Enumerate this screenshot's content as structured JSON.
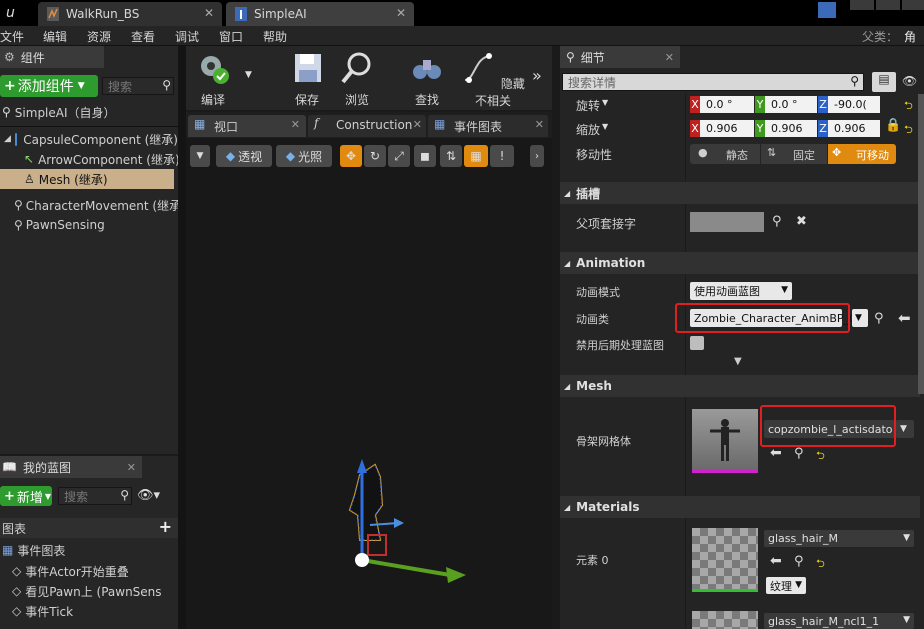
{
  "tabs": [
    {
      "label": "WalkRun_BS"
    },
    {
      "label": "SimpleAI"
    }
  ],
  "menu": [
    "文件",
    "编辑",
    "资源",
    "查看",
    "调试",
    "窗口",
    "帮助"
  ],
  "parent_label": "父类：",
  "parent_value": "角色",
  "components": {
    "header": "组件",
    "add_button": "添加组件",
    "search_placeholder": "搜索",
    "self_item": "SimpleAI（自身）",
    "items": [
      "CapsuleComponent (继承)",
      "ArrowComponent (继承)",
      "Mesh (继承)",
      "CharacterMovement (继承)",
      "PawnSensing"
    ]
  },
  "toolbar": {
    "compile": "编译",
    "save": "保存",
    "browse": "浏览",
    "find": "查找",
    "hide_unrelated": "隐藏不相关"
  },
  "editor_tabs": [
    "视口",
    "Construction",
    "事件图表"
  ],
  "viewport": {
    "perspective": "透视",
    "lit": "光照"
  },
  "my_blueprint": {
    "header": "我的蓝图",
    "new_button": "新增",
    "search_placeholder": "搜索",
    "graphs_label": "图表",
    "event_graph": "事件图表",
    "events": [
      "事件Actor开始重叠",
      "看见Pawn上 (PawnSens",
      "事件Tick"
    ]
  },
  "details": {
    "header": "细节",
    "search_placeholder": "搜索详情",
    "rotation_label": "旋转",
    "rotation": [
      "0.0 °",
      "0.0 °",
      "-90.0("
    ],
    "scale_label": "缩放",
    "scale": [
      "0.906",
      "0.906",
      "0.906"
    ],
    "mobility_label": "移动性",
    "mobility": [
      "静态",
      "固定",
      "可移动"
    ],
    "socket_section": "插槽",
    "parent_socket_label": "父项套接字",
    "animation_section": "Animation",
    "anim_mode_label": "动画模式",
    "anim_mode_value": "使用动画蓝图",
    "anim_class_label": "动画类",
    "anim_class_value": "Zombie_Character_AnimBP_C",
    "disable_post_label": "禁用后期处理蓝图",
    "mesh_section": "Mesh",
    "skeletal_mesh_label": "骨架网格体",
    "skeletal_mesh_value": "copzombie_l_actisdato",
    "materials_section": "Materials",
    "element0_label": "元素 0",
    "material0": "glass_hair_M",
    "texture_button": "纹理",
    "material1": "glass_hair_M_ncl1_1"
  },
  "colors": {
    "accent_orange": "#e08a10",
    "add_green": "#2e9b2e",
    "highlight_red": "#e02020",
    "selection_tan": "#c9b08a"
  }
}
